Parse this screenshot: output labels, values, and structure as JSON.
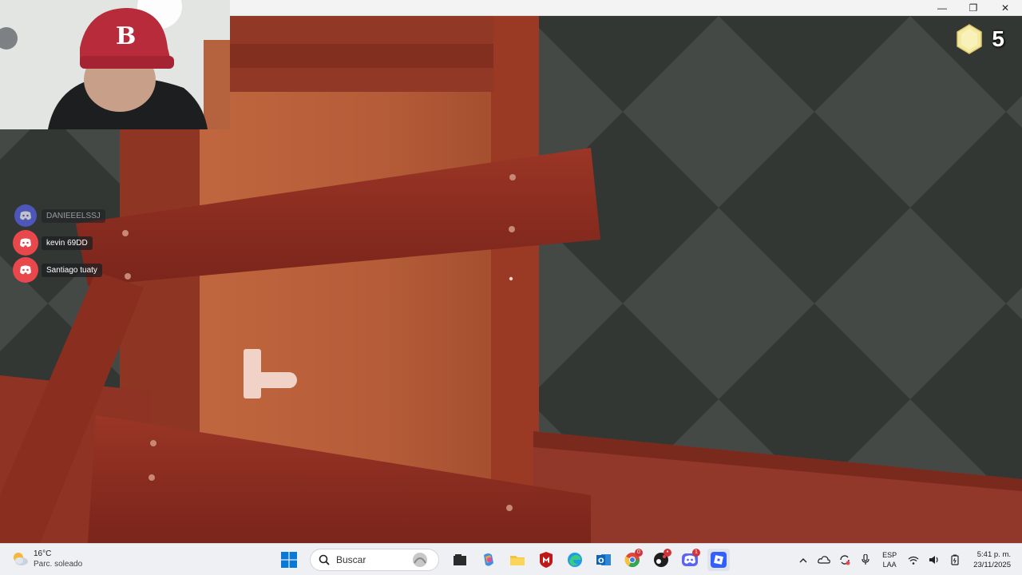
{
  "window": {
    "controls": [
      "—",
      "❐",
      "✕"
    ]
  },
  "hud": {
    "coin_count": "5",
    "coin_color": "#f4e9a0"
  },
  "discord_overlay": {
    "users": [
      {
        "name": "DANIEEELSSJ",
        "speaking": false
      },
      {
        "name": "kevin 69DD",
        "speaking": true
      },
      {
        "name": "Santiago tuaty",
        "speaking": true
      }
    ],
    "accent_speaking": "#e8474b",
    "accent_idle": "#5865f2"
  },
  "taskbar": {
    "weather": {
      "temp": "16°C",
      "desc": "Parc. soleado",
      "icon": "partly-sunny-icon"
    },
    "search": {
      "placeholder": "Buscar"
    },
    "apps": [
      {
        "name": "file-explorer-icon",
        "badge": ""
      },
      {
        "name": "copilot-icon",
        "badge": ""
      },
      {
        "name": "folder-icon",
        "badge": ""
      },
      {
        "name": "mcafee-icon",
        "badge": ""
      },
      {
        "name": "edge-icon",
        "badge": ""
      },
      {
        "name": "outlook-icon",
        "badge": ""
      },
      {
        "name": "chrome-icon",
        "badge": "0"
      },
      {
        "name": "app-dark-icon",
        "badge": "•"
      },
      {
        "name": "discord-icon",
        "badge": "1"
      },
      {
        "name": "roblox-icon",
        "badge": ""
      }
    ],
    "tray": {
      "lang_top": "ESP",
      "lang_bottom": "LAA",
      "time": "5:41 p. m.",
      "date": "23/11/2025"
    }
  }
}
